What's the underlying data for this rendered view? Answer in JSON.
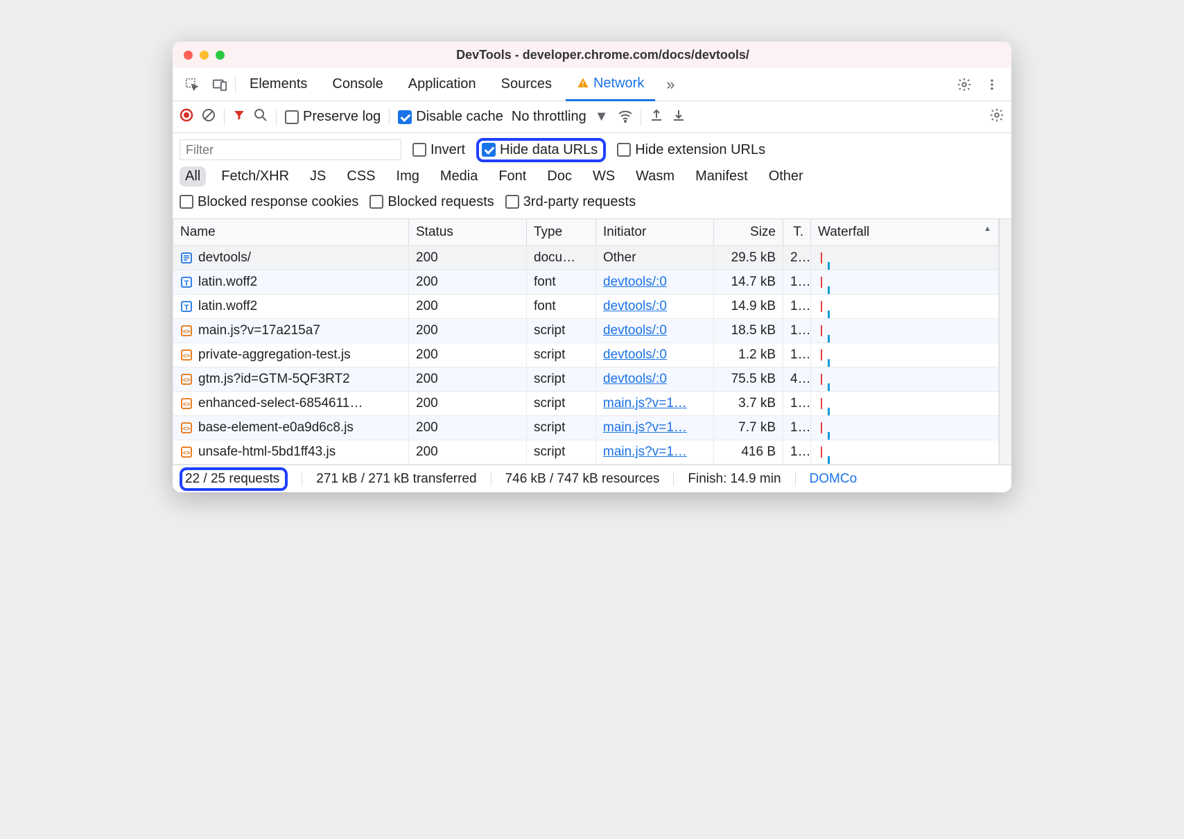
{
  "window": {
    "title": "DevTools - developer.chrome.com/docs/devtools/"
  },
  "tabs": [
    "Elements",
    "Console",
    "Application",
    "Sources",
    "Network"
  ],
  "toolbar": {
    "preserve_log": "Preserve log",
    "disable_cache": "Disable cache",
    "throttling": "No throttling"
  },
  "filters": {
    "filter_placeholder": "Filter",
    "invert": "Invert",
    "hide_data_urls": "Hide data URLs",
    "hide_extension_urls": "Hide extension URLs",
    "types": [
      "All",
      "Fetch/XHR",
      "JS",
      "CSS",
      "Img",
      "Media",
      "Font",
      "Doc",
      "WS",
      "Wasm",
      "Manifest",
      "Other"
    ],
    "blocked_response_cookies": "Blocked response cookies",
    "blocked_requests": "Blocked requests",
    "third_party": "3rd-party requests"
  },
  "columns": {
    "name": "Name",
    "status": "Status",
    "type": "Type",
    "initiator": "Initiator",
    "size": "Size",
    "time": "T.",
    "waterfall": "Waterfall"
  },
  "rows": [
    {
      "icon": "doc",
      "name": "devtools/",
      "status": "200",
      "type": "docu…",
      "initiator": "Other",
      "initiator_link": false,
      "size": "29.5 kB",
      "time": "2.."
    },
    {
      "icon": "font",
      "name": "latin.woff2",
      "status": "200",
      "type": "font",
      "initiator": "devtools/:0",
      "initiator_link": true,
      "size": "14.7 kB",
      "time": "1.."
    },
    {
      "icon": "font",
      "name": "latin.woff2",
      "status": "200",
      "type": "font",
      "initiator": "devtools/:0",
      "initiator_link": true,
      "size": "14.9 kB",
      "time": "1.."
    },
    {
      "icon": "js",
      "name": "main.js?v=17a215a7",
      "status": "200",
      "type": "script",
      "initiator": "devtools/:0",
      "initiator_link": true,
      "size": "18.5 kB",
      "time": "1.."
    },
    {
      "icon": "js",
      "name": "private-aggregation-test.js",
      "status": "200",
      "type": "script",
      "initiator": "devtools/:0",
      "initiator_link": true,
      "size": "1.2 kB",
      "time": "1.."
    },
    {
      "icon": "js",
      "name": "gtm.js?id=GTM-5QF3RT2",
      "status": "200",
      "type": "script",
      "initiator": "devtools/:0",
      "initiator_link": true,
      "size": "75.5 kB",
      "time": "4.."
    },
    {
      "icon": "js",
      "name": "enhanced-select-6854611…",
      "status": "200",
      "type": "script",
      "initiator": "main.js?v=1…",
      "initiator_link": true,
      "size": "3.7 kB",
      "time": "1.."
    },
    {
      "icon": "js",
      "name": "base-element-e0a9d6c8.js",
      "status": "200",
      "type": "script",
      "initiator": "main.js?v=1…",
      "initiator_link": true,
      "size": "7.7 kB",
      "time": "1.."
    },
    {
      "icon": "js",
      "name": "unsafe-html-5bd1ff43.js",
      "status": "200",
      "type": "script",
      "initiator": "main.js?v=1…",
      "initiator_link": true,
      "size": "416 B",
      "time": "1.."
    }
  ],
  "status": {
    "requests": "22 / 25 requests",
    "transferred": "271 kB / 271 kB transferred",
    "resources": "746 kB / 747 kB resources",
    "finish": "Finish: 14.9 min",
    "domco": "DOMCo"
  }
}
